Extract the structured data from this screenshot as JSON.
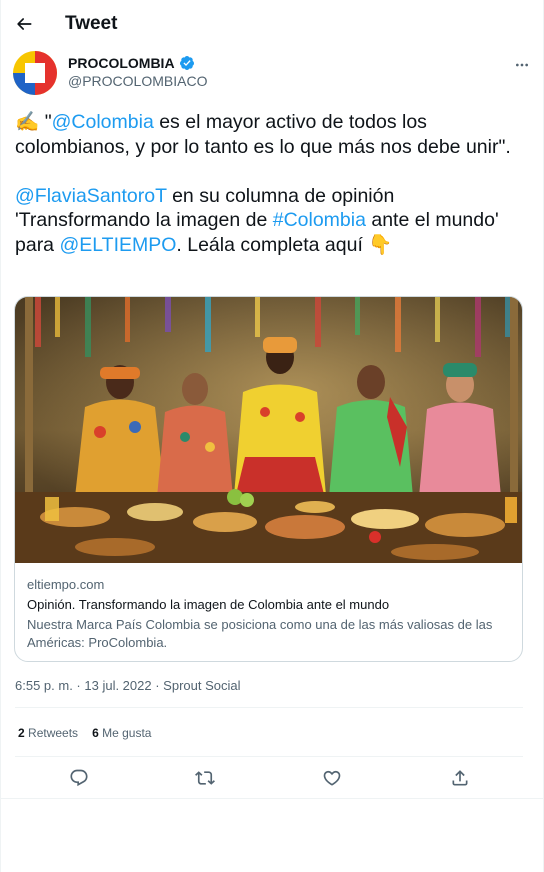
{
  "header": {
    "title": "Tweet"
  },
  "author": {
    "name": "PROCOLOMBIA",
    "handle": "@PROCOLOMBIACO",
    "colors": {
      "yellow": "#f7c600",
      "red": "#e5322d",
      "blue": "#1f63c6"
    }
  },
  "tweet": {
    "emoji_lead": "✍️",
    "quote_open": " \"",
    "mention_colombia": "@Colombia",
    "text_1": " es el mayor activo de todos los colombianos, y por lo tanto es lo que más nos debe unir\".",
    "mention_flavia": "@FlaviaSantoroT",
    "text_2": " en su columna de opinión 'Transformando la imagen de ",
    "hashtag": "#Colombia",
    "text_3": " ante el mundo' para ",
    "mention_eltiempo": "@ELTIEMPO",
    "text_4": ". Leála completa aquí ",
    "emoji_point": "👇"
  },
  "card": {
    "domain": "eltiempo.com",
    "title": "Opinión. Transformando la imagen de Colombia ante el mundo",
    "description": "Nuestra Marca País Colombia se posiciona como una de las más valiosas de las Américas: ProColombia."
  },
  "meta": {
    "time": "6:55 p. m.",
    "sep1": " · ",
    "date": "13 jul. 2022",
    "sep2": " · ",
    "source": "Sprout Social"
  },
  "stats": {
    "retweets_count": "2",
    "retweets_label": "Retweets",
    "likes_count": "6",
    "likes_label": "Me gusta"
  },
  "theme": {
    "link_color": "#1d9bf0",
    "text": "#0f1419",
    "muted": "#536471",
    "verified": "#1d9bf0"
  },
  "icons": {
    "back": "arrow-left-icon",
    "verified": "verified-badge-icon",
    "more": "more-icon",
    "reply": "reply-icon",
    "retweet": "retweet-icon",
    "like": "like-icon",
    "share": "share-icon"
  }
}
